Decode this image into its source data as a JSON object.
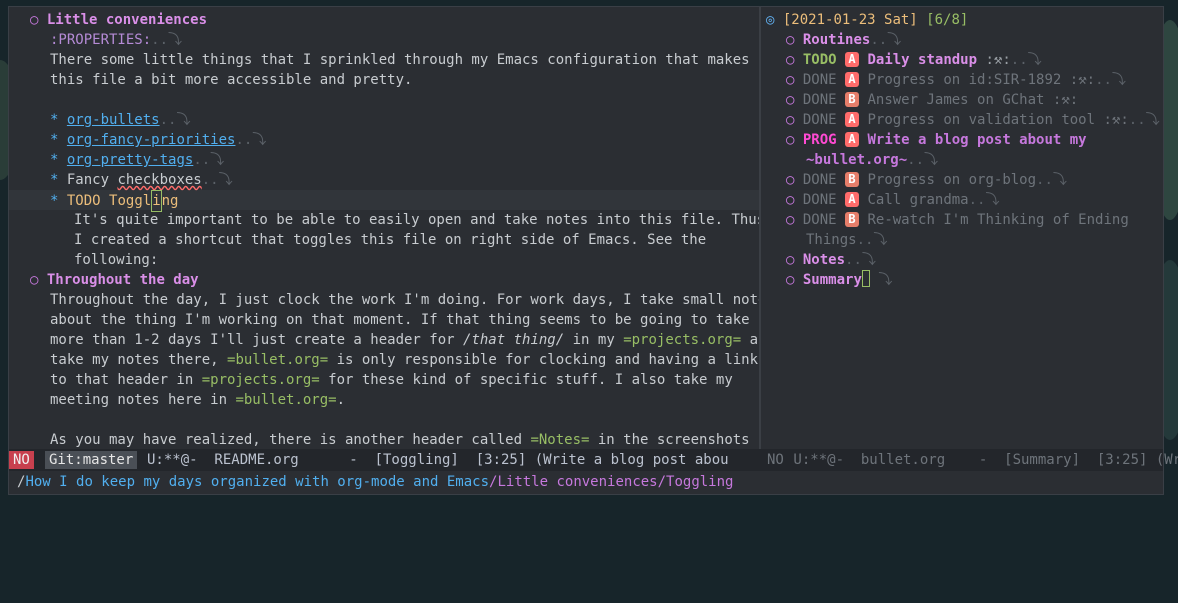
{
  "left": {
    "heading1": "Little conveniences",
    "properties": ":PROPERTIES:",
    "para1": [
      "There some little things that I sprinkled through my Emacs configuration that makes",
      "this file a bit more accessible and pretty."
    ],
    "items": [
      "org-bullets",
      "org-fancy-priorities",
      "org-pretty-tags"
    ],
    "fancy_checkboxes_prefix": "Fancy ",
    "fancy_checkboxes_word": "checkboxes",
    "todo_kw": "TODO",
    "todo_title_a": "Toggl",
    "todo_title_cursor": "i",
    "todo_title_b": "ng",
    "toggle_text": [
      "It's quite important to be able to easily open and take notes into this file. Thus,",
      "I created a shortcut that toggles this file on right side of Emacs. See the",
      "following:"
    ],
    "heading2": "Throughout the day",
    "p1": "Throughout the day, I just clock the work I'm doing. For work days, I take small notes",
    "p2": "about the thing I'm working on that moment. If that thing seems to be going to take",
    "p3a": "more than 1-2 days I'll just create a header for ",
    "p3b": "/that thing/",
    "p3c": " in my ",
    "p3d": "=projects.org=",
    "p3e": " and",
    "p4a": "take my notes there, ",
    "p4b": "=bullet.org=",
    "p4c": " is only responsible for clocking and having a link",
    "p5a": "to that header in ",
    "p5b": "=projects.org=",
    "p5c": " for these kind of specific stuff. I also take my",
    "p6a": "meeting notes here in ",
    "p6b": "=bullet.org=",
    "p6c": ".",
    "p7a": "As you may have realized, there is another header called ",
    "p7b": "=Notes=",
    "p7c": " in the screenshots"
  },
  "right": {
    "date": "[2021-01-23 Sat]",
    "cookie": "[6/8]",
    "routines": "Routines",
    "tasks": [
      {
        "kw": "TODO",
        "prio": "A",
        "title": "Daily standup",
        "tag": " :⚒:"
      },
      {
        "kw": "DONE",
        "prio": "A",
        "title": "Progress on id:SIR-1892",
        "tag": " :⚒:"
      },
      {
        "kw": "DONE",
        "prio": "B",
        "title": "Answer James on GChat",
        "tag": " :⚒:"
      },
      {
        "kw": "DONE",
        "prio": "A",
        "title": "Progress on validation tool",
        "tag": " :⚒:"
      }
    ],
    "prog": {
      "kw": "PROG",
      "prio": "A",
      "title1": "Write a blog post about my",
      "title2": "~bullet.org~"
    },
    "tasks2": [
      {
        "kw": "DONE",
        "prio": "B",
        "title": "Progress on org-blog"
      },
      {
        "kw": "DONE",
        "prio": "A",
        "title": "Call grandma"
      }
    ],
    "rewatch": {
      "kw": "DONE",
      "prio": "B",
      "title1": "Re-watch I'm Thinking of Ending",
      "title2": "Things"
    },
    "notes": "Notes",
    "summary": "Summary"
  },
  "modeline": {
    "state": "NO",
    "git": "Git:master",
    "left_status": "U:**@-  README.org      -  [Toggling]  [3:25] (Write a blog post abou",
    "right_state": "NO",
    "right_status": " U:**@-  bullet.org    -  [Summary]  [3:25] (Wr"
  },
  "minibuffer": {
    "sep": "/",
    "link": "How I do keep my days organized with org-mode and Emacs",
    "path": "Little conveniences/Toggling"
  },
  "colors": {
    "accent": "#c678dd",
    "todo": "#98be65",
    "prog": "#ff4ad3",
    "link": "#51afef",
    "priority_a": "#ff6c6b"
  }
}
